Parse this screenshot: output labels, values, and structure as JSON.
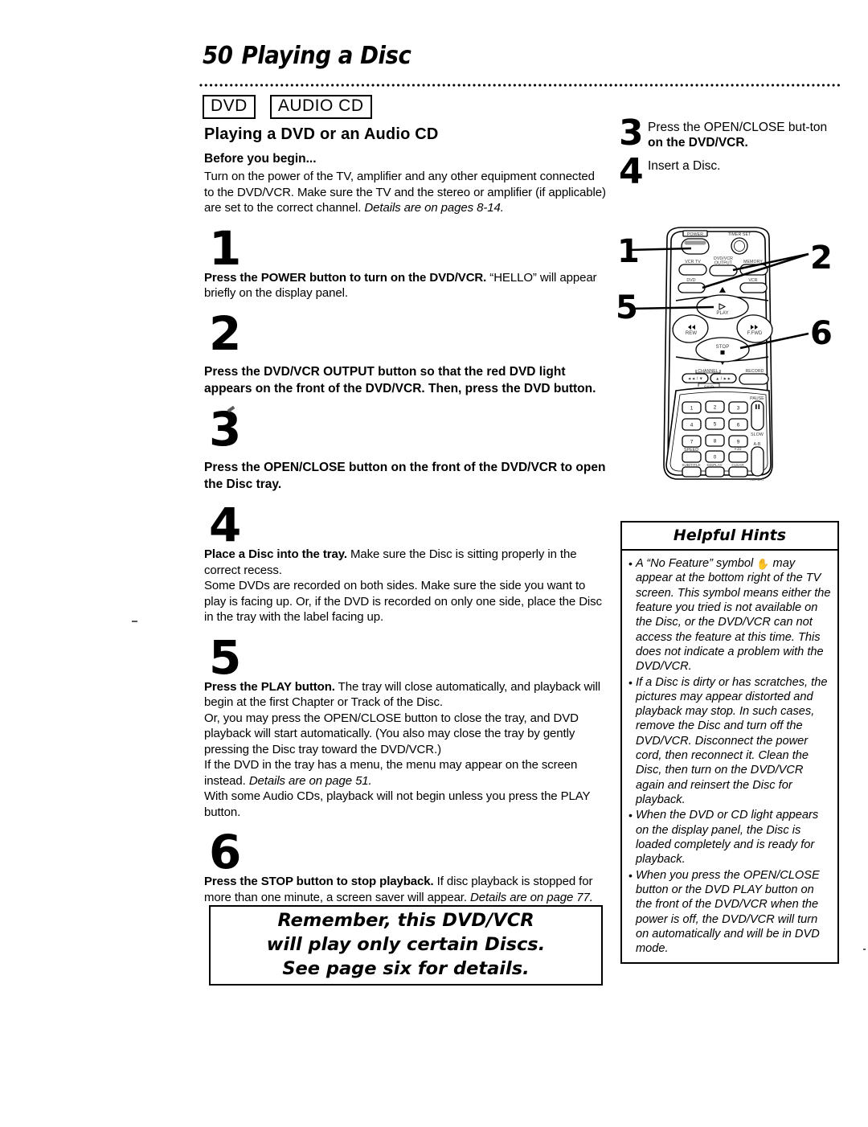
{
  "header": {
    "page_number": "50",
    "title": "Playing a Disc",
    "disc_tags": [
      "DVD",
      "AUDIO CD"
    ]
  },
  "left_column": {
    "section_heading": "Playing a DVD or an Audio CD",
    "before_heading": "Before you begin...",
    "before_text_plain": "Turn on the power of the TV, amplifier and any other equipment connected to the DVD/VCR. Make sure the TV and the stereo or amplifier (if applicable) are set to the correct channel.",
    "before_text_italic": "Details are on pages 8-14.",
    "steps": [
      {
        "number": "1",
        "lead": "Press the POWER button to turn on the DVD/VCR.",
        "rest": " “HELLO” will appear briefly on the display panel."
      },
      {
        "number": "2",
        "lead": "Press the DVD/VCR OUTPUT button so that the red DVD light appears on the front of the DVD/VCR. Then, press the DVD button.",
        "rest": ""
      },
      {
        "number": "3",
        "lead": "Press the OPEN/CLOSE button on the front of the DVD/VCR to open the Disc tray.",
        "rest": ""
      },
      {
        "number": "4",
        "lead": "Place a Disc into the tray.",
        "rest": " Make sure the Disc is sitting properly in the correct recess.",
        "rest2": "Some DVDs are recorded on both sides. Make sure the side you want to play is facing up. Or, if the DVD is recorded on only one side, place the Disc in the tray with the label facing up."
      },
      {
        "number": "5",
        "lead": "Press the PLAY button.",
        "rest": " The tray will close automatically, and playback will begin at the first Chapter or Track of the Disc.",
        "rest2": "Or, you may press the OPEN/CLOSE button to close the tray, and DVD playback will start automatically. (You also may close the tray by gently pressing the Disc tray toward the DVD/VCR.)",
        "rest3": "If the DVD in the tray has a menu, the menu may appear on the screen instead. ",
        "rest3_italic": "Details are on page 51.",
        "rest4": "With some Audio CDs, playback will not begin unless you press the PLAY button."
      },
      {
        "number": "6",
        "lead": "Press the STOP button to stop playback.",
        "rest": " If disc playback is stopped for more than one minute, a screen saver will appear. ",
        "rest_italic": "Details are on page 77."
      }
    ],
    "remember_box": [
      "Remember, this DVD/VCR",
      "will play only certain Discs.",
      "See page six for details."
    ]
  },
  "right_column": {
    "steps": [
      {
        "number": "3",
        "text_plain": "Press the OPEN/CLOSE but-ton ",
        "text_line1_plain": "Press the OPEN/CLOSE but-",
        "text_line2_plain": "ton ",
        "text_line2_bold": "on the DVD/VCR."
      },
      {
        "number": "4",
        "text_plain": "Insert a Disc."
      }
    ],
    "remote": {
      "callouts": [
        "1",
        "2",
        "5",
        "6"
      ],
      "button_labels": {
        "power": "POWER",
        "timer_set": "TIMER SET",
        "vcr_tv": "VCR TV",
        "dvd_vcr_output": "DVD/VCR OUTPUT",
        "memory": "MEMORY",
        "dvd": "DVD",
        "vcr": "VCR",
        "play": "PLAY",
        "rew": "REW",
        "ffwd": "F.FWD",
        "stop": "STOP",
        "channel": "CHANNEL",
        "skip": "SKIP",
        "record": "RECORD",
        "pause": "PAUSE",
        "slow": "SLOW",
        "ab": "A-B",
        "repeat": "REPEAT",
        "speed": "SPEED",
        "plus_ten": "+10",
        "subtitle": "SUB/TITLE",
        "display": "DISPLAY",
        "clear": "CLEAR",
        "keypad": [
          "1",
          "2",
          "3",
          "4",
          "5",
          "6",
          "7",
          "8",
          "9",
          "0"
        ]
      }
    },
    "hints": {
      "title": "Helpful Hints",
      "items": [
        {
          "pre": "A “No Feature” symbol ",
          "symbol": "✋",
          "post": " may appear at the bottom right of the TV screen. This symbol means either the feature you tried is not available on the Disc, or the DVD/VCR can not access the feature at this time. This does not indicate a problem with the DVD/VCR."
        },
        {
          "pre": "",
          "symbol": "",
          "post": "If a Disc is dirty or has scratches, the pictures may appear distorted and playback may stop. In such cases, remove the Disc and turn off the DVD/VCR. Disconnect the power cord, then reconnect it. Clean the Disc, then turn on the DVD/VCR again and reinsert the Disc for playback."
        },
        {
          "pre": "",
          "symbol": "",
          "post": "When the DVD or CD light appears on the display panel, the Disc is loaded completely and is ready for playback."
        },
        {
          "pre": "",
          "symbol": "",
          "post": "When you press the OPEN/CLOSE button or the DVD PLAY button on the front of the DVD/VCR when the power is off, the DVD/VCR will turn on automatically and will be in DVD mode."
        }
      ]
    }
  }
}
